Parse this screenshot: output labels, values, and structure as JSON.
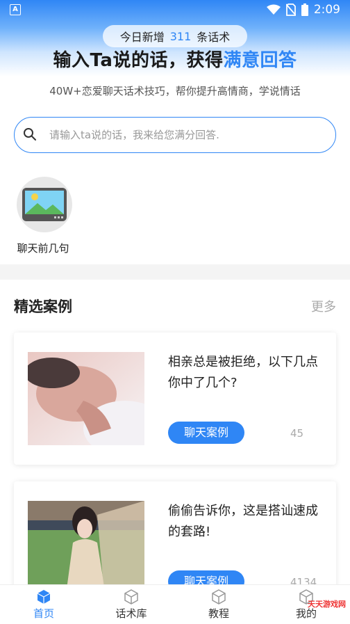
{
  "status_bar": {
    "app_badge": "A",
    "time": "2:09"
  },
  "banner": {
    "pill_prefix": "今日新增",
    "pill_count": "311",
    "pill_suffix": "条话术",
    "headline_main": "输入Ta说的话，获得",
    "headline_highlight": "满意回答",
    "subline": "40W+恋爱聊天话术技巧，帮你提升高情商，学说情话"
  },
  "search": {
    "placeholder": "请输入ta说的话，我来给您满分回答."
  },
  "categories": [
    {
      "label": "聊天前几句",
      "icon": "image-icon"
    }
  ],
  "section": {
    "title": "精选案例",
    "more": "更多"
  },
  "cases": [
    {
      "title": "相亲总是被拒绝，以下几点你中了几个?",
      "button": "聊天案例",
      "count": "45"
    },
    {
      "title": "偷偷告诉你，这是搭讪速成的套路!",
      "button": "聊天案例",
      "count": "4134"
    }
  ],
  "tabbar": [
    {
      "label": "首页",
      "icon": "cube-icon",
      "active": true
    },
    {
      "label": "话术库",
      "icon": "cube-icon",
      "active": false
    },
    {
      "label": "教程",
      "icon": "cube-icon",
      "active": false
    },
    {
      "label": "我的",
      "icon": "cube-icon",
      "active": false
    }
  ],
  "watermark": "天天游戏网",
  "colors": {
    "accent": "#2f86f5",
    "muted": "#aaaaaa"
  }
}
